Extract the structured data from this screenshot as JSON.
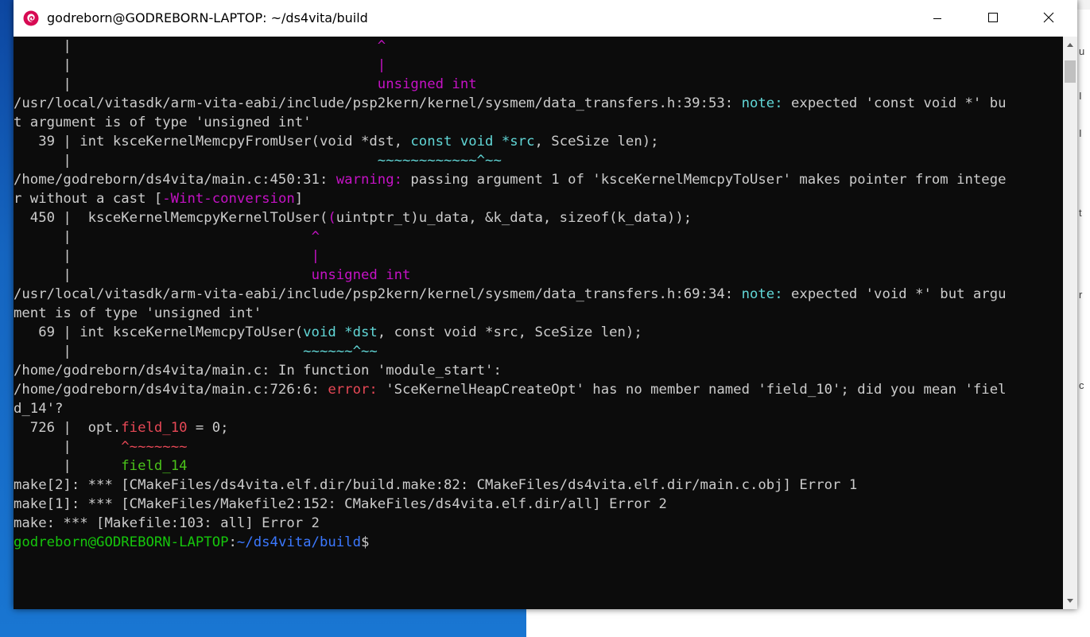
{
  "window": {
    "title": "godreborn@GODREBORN-LAPTOP: ~/ds4vita/build"
  },
  "terminal_lines": [
    {
      "row": 0,
      "segments": [
        {
          "t": "      |                                     ",
          "c": ""
        },
        {
          "t": "^",
          "c": "mag"
        }
      ]
    },
    {
      "row": 1,
      "segments": [
        {
          "t": "      |                                     ",
          "c": ""
        },
        {
          "t": "|",
          "c": "mag"
        }
      ]
    },
    {
      "row": 2,
      "segments": [
        {
          "t": "      |                                     ",
          "c": ""
        },
        {
          "t": "unsigned int",
          "c": "mag"
        }
      ]
    },
    {
      "row": 3,
      "segments": [
        {
          "t": "/usr/local/vitasdk/arm-vita-eabi/include/psp2kern/kernel/sysmem/data_transfers.h:39:53: ",
          "c": ""
        },
        {
          "t": "note:",
          "c": "cyan"
        },
        {
          "t": " expected 'const void *' bu",
          "c": ""
        }
      ]
    },
    {
      "row": 4,
      "segments": [
        {
          "t": "t argument is of type 'unsigned int'",
          "c": ""
        }
      ]
    },
    {
      "row": 5,
      "segments": [
        {
          "t": "   39 | int ksceKernelMemcpyFromUser(void *dst, ",
          "c": ""
        },
        {
          "t": "const void *src",
          "c": "cyan"
        },
        {
          "t": ", SceSize len);",
          "c": ""
        }
      ]
    },
    {
      "row": 6,
      "segments": [
        {
          "t": "      |                                     ",
          "c": ""
        },
        {
          "t": "~~~~~~~~~~~~^~~",
          "c": "cyan"
        }
      ]
    },
    {
      "row": 7,
      "segments": [
        {
          "t": "/home/godreborn/ds4vita/main.c:450:31: ",
          "c": ""
        },
        {
          "t": "warning:",
          "c": "mag"
        },
        {
          "t": " passing argument 1 of 'ksceKernelMemcpyToUser' makes pointer from intege",
          "c": ""
        }
      ]
    },
    {
      "row": 8,
      "segments": [
        {
          "t": "r without a cast [",
          "c": ""
        },
        {
          "t": "-Wint-conversion",
          "c": "mag"
        },
        {
          "t": "]",
          "c": ""
        }
      ]
    },
    {
      "row": 9,
      "segments": [
        {
          "t": "  450 |  ksceKernelMemcpyKernelToUser(",
          "c": ""
        },
        {
          "t": "(",
          "c": "mag"
        },
        {
          "t": "uintptr_t)u_data, &k_data, sizeof(k_data));",
          "c": ""
        }
      ]
    },
    {
      "row": 10,
      "segments": [
        {
          "t": "      |                             ",
          "c": ""
        },
        {
          "t": "^",
          "c": "mag"
        }
      ]
    },
    {
      "row": 11,
      "segments": [
        {
          "t": "      |                             ",
          "c": ""
        },
        {
          "t": "|",
          "c": "mag"
        }
      ]
    },
    {
      "row": 12,
      "segments": [
        {
          "t": "      |                             ",
          "c": ""
        },
        {
          "t": "unsigned int",
          "c": "mag"
        }
      ]
    },
    {
      "row": 13,
      "segments": [
        {
          "t": "/usr/local/vitasdk/arm-vita-eabi/include/psp2kern/kernel/sysmem/data_transfers.h:69:34: ",
          "c": ""
        },
        {
          "t": "note:",
          "c": "cyan"
        },
        {
          "t": " expected 'void *' but argu",
          "c": ""
        }
      ]
    },
    {
      "row": 14,
      "segments": [
        {
          "t": "ment is of type 'unsigned int'",
          "c": ""
        }
      ]
    },
    {
      "row": 15,
      "segments": [
        {
          "t": "   69 | int ksceKernelMemcpyToUser(",
          "c": ""
        },
        {
          "t": "void *dst",
          "c": "cyan"
        },
        {
          "t": ", const void *src, SceSize len);",
          "c": ""
        }
      ]
    },
    {
      "row": 16,
      "segments": [
        {
          "t": "      |                            ",
          "c": ""
        },
        {
          "t": "~~~~~~^~~",
          "c": "cyan"
        }
      ]
    },
    {
      "row": 17,
      "segments": [
        {
          "t": "/home/godreborn/ds4vita/main.c: In function 'module_start':",
          "c": ""
        }
      ]
    },
    {
      "row": 18,
      "segments": [
        {
          "t": "/home/godreborn/ds4vita/main.c:726:6: ",
          "c": ""
        },
        {
          "t": "error:",
          "c": "red"
        },
        {
          "t": " 'SceKernelHeapCreateOpt' has no member named 'field_10'; did you mean 'fiel",
          "c": ""
        }
      ]
    },
    {
      "row": 19,
      "segments": [
        {
          "t": "d_14'?",
          "c": ""
        }
      ]
    },
    {
      "row": 20,
      "segments": [
        {
          "t": "  726 |  opt.",
          "c": ""
        },
        {
          "t": "field_10",
          "c": "red"
        },
        {
          "t": " = 0;",
          "c": ""
        }
      ]
    },
    {
      "row": 21,
      "segments": [
        {
          "t": "      |      ",
          "c": ""
        },
        {
          "t": "^~~~~~~~",
          "c": "red"
        }
      ]
    },
    {
      "row": 22,
      "segments": [
        {
          "t": "      |      ",
          "c": ""
        },
        {
          "t": "field_14",
          "c": "green"
        }
      ]
    },
    {
      "row": 23,
      "segments": [
        {
          "t": "make[2]: *** [CMakeFiles/ds4vita.elf.dir/build.make:82: CMakeFiles/ds4vita.elf.dir/main.c.obj] Error 1",
          "c": ""
        }
      ]
    },
    {
      "row": 24,
      "segments": [
        {
          "t": "make[1]: *** [CMakeFiles/Makefile2:152: CMakeFiles/ds4vita.elf.dir/all] Error 2",
          "c": ""
        }
      ]
    },
    {
      "row": 25,
      "segments": [
        {
          "t": "make: *** [Makefile:103: all] Error 2",
          "c": ""
        }
      ]
    },
    {
      "row": 26,
      "segments": [
        {
          "t": "godreborn@GODREBORN-LAPTOP",
          "c": "prompt-green"
        },
        {
          "t": ":",
          "c": ""
        },
        {
          "t": "~/ds4vita/build",
          "c": "blue"
        },
        {
          "t": "$",
          "c": ""
        }
      ]
    }
  ],
  "colors": {
    "terminal_bg": "#0c0c0c",
    "text": "#cccccc",
    "magenta": "#c512c5",
    "cyan": "#61d6d6",
    "red": "#e74856",
    "green": "#4ac21a",
    "prompt_green": "#16c60c",
    "blue": "#3b78ff",
    "app_icon": "#d70a53"
  },
  "icons": {
    "app": "debian-swirl-icon",
    "minimize": "minimize-icon",
    "maximize": "maximize-icon",
    "close": "close-icon"
  },
  "background_right_glyphs": [
    "u",
    "I",
    "I",
    "t",
    "r",
    "c"
  ]
}
